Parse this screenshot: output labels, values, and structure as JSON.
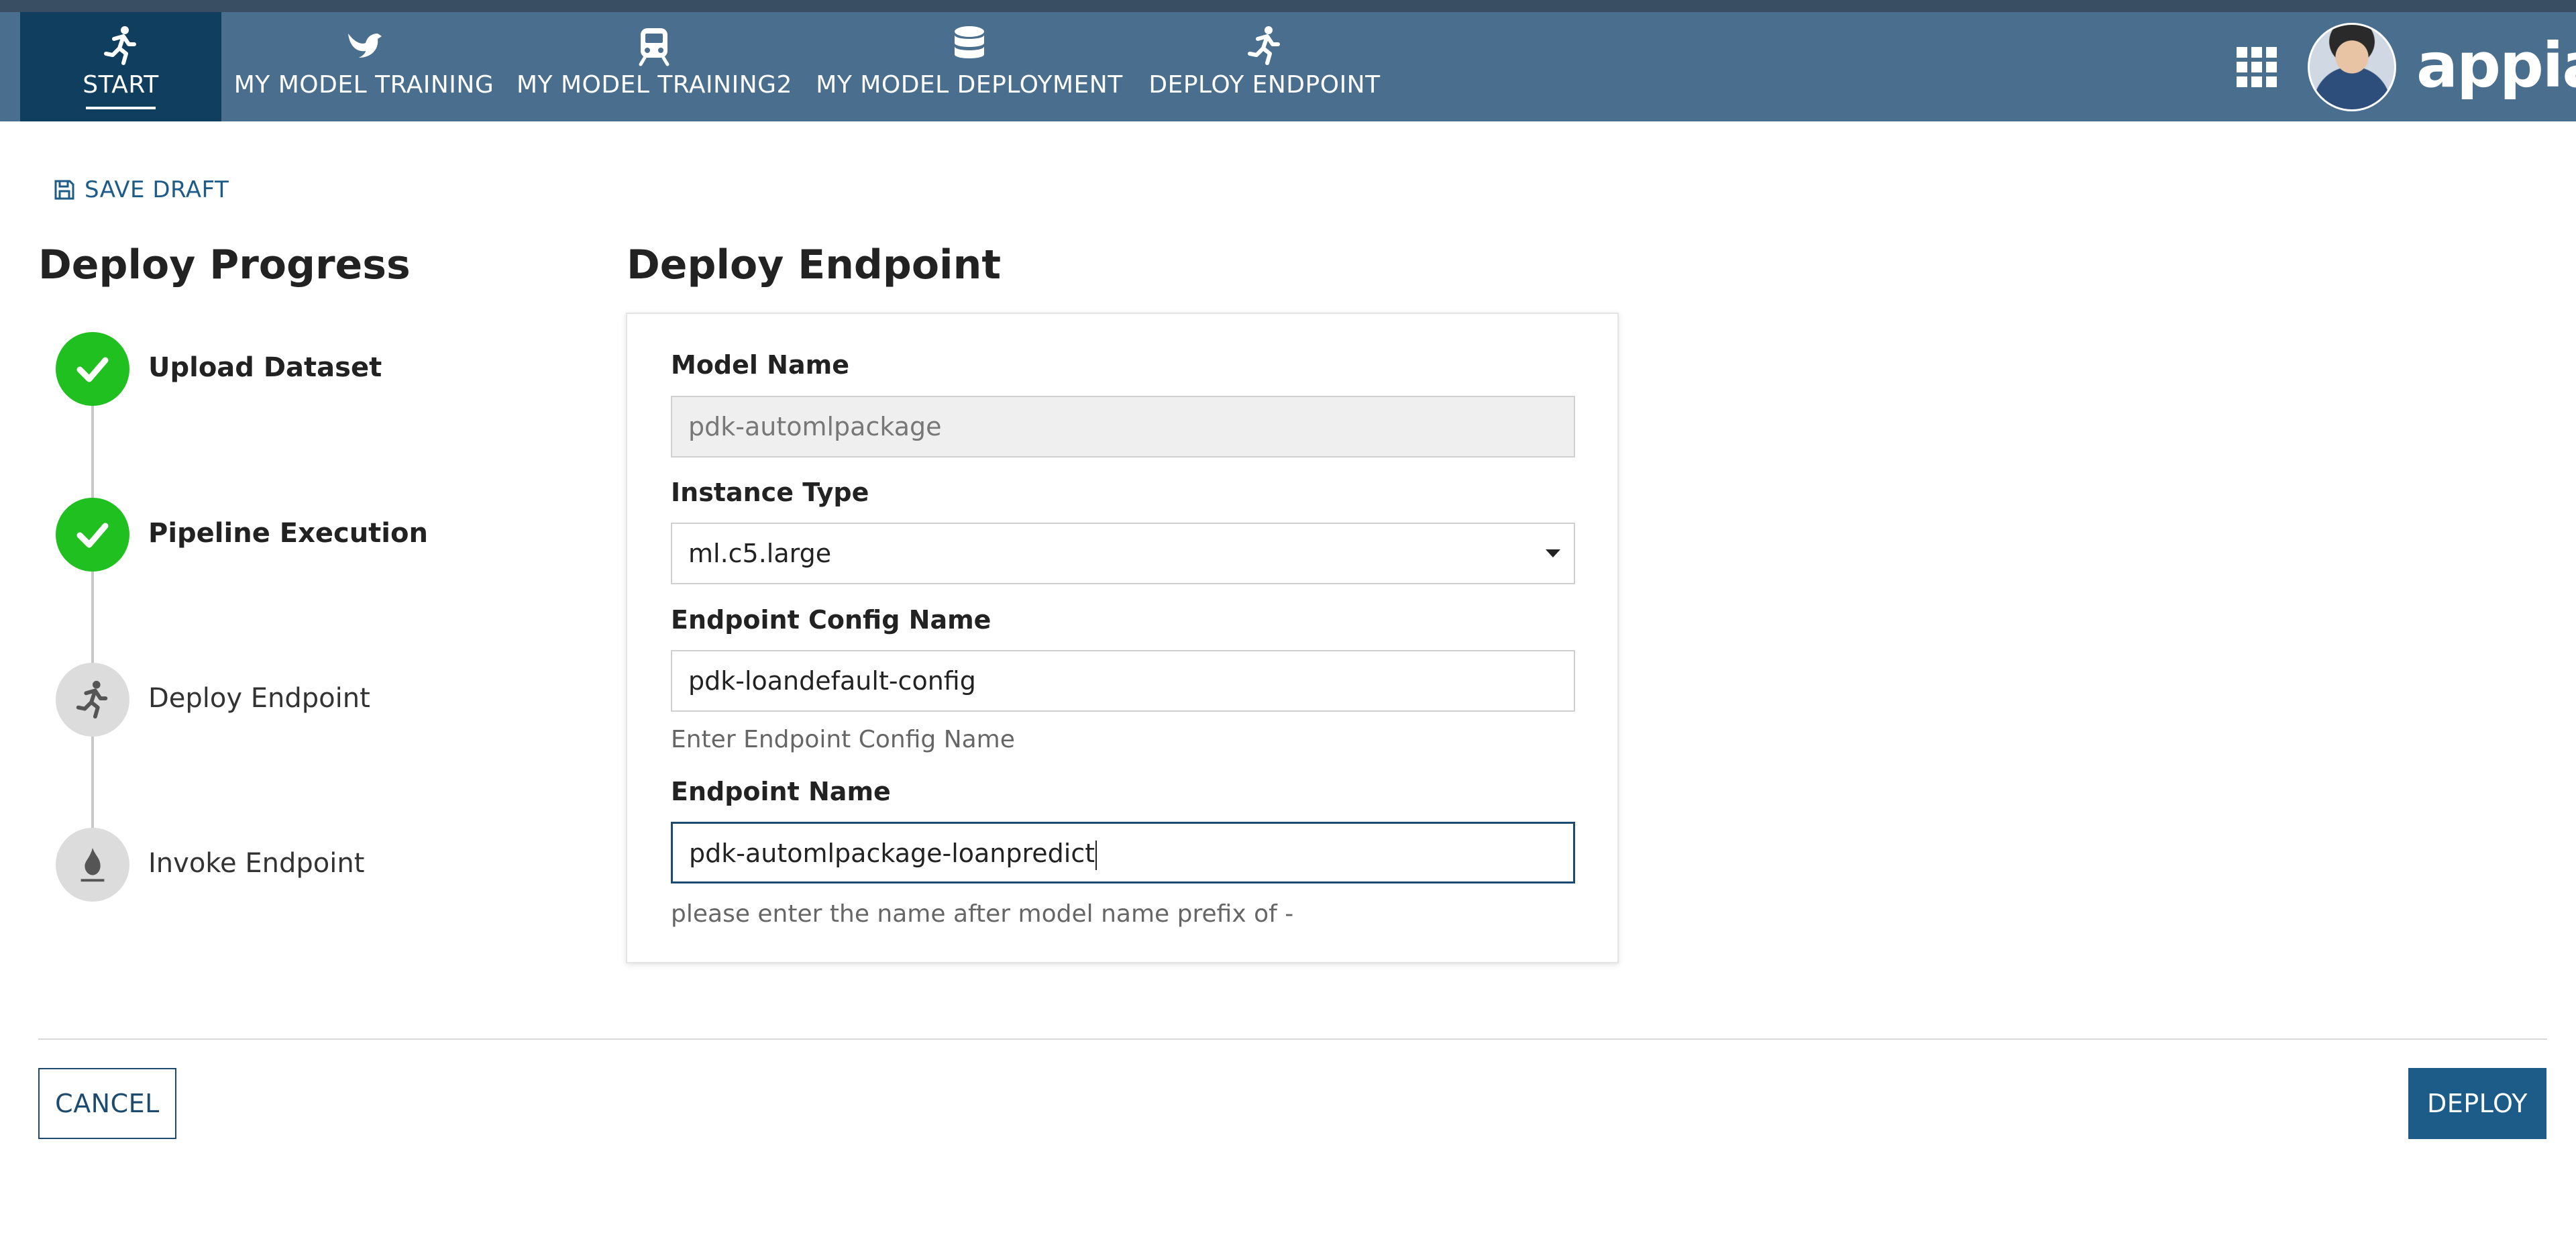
{
  "nav": {
    "items": [
      {
        "label": "START",
        "icon": "runner-icon"
      },
      {
        "label": "MY MODEL TRAINING",
        "icon": "bird-icon"
      },
      {
        "label": "MY MODEL TRAINING2",
        "icon": "train-icon"
      },
      {
        "label": "MY MODEL DEPLOYMENT",
        "icon": "database-icon"
      },
      {
        "label": "DEPLOY ENDPOINT",
        "icon": "runner-icon"
      }
    ],
    "active_index": 0,
    "logo": "appian"
  },
  "toolbar": {
    "save_draft_label": "SAVE DRAFT"
  },
  "progress": {
    "title": "Deploy Progress",
    "steps": [
      {
        "label": "Upload Dataset",
        "status": "done"
      },
      {
        "label": "Pipeline Execution",
        "status": "done"
      },
      {
        "label": "Deploy Endpoint",
        "status": "current"
      },
      {
        "label": "Invoke Endpoint",
        "status": "pending"
      }
    ]
  },
  "form": {
    "title": "Deploy Endpoint",
    "model_name": {
      "label": "Model Name",
      "value": "pdk-automlpackage"
    },
    "instance_type": {
      "label": "Instance Type",
      "value": "ml.c5.large"
    },
    "endpoint_config_name": {
      "label": "Endpoint Config Name",
      "value": "pdk-loandefault-config",
      "helper": "Enter Endpoint Config Name"
    },
    "endpoint_name": {
      "label": "Endpoint Name",
      "value": "pdk-automlpackage-loanpredict",
      "helper": "please enter the name after model name prefix of -"
    }
  },
  "actions": {
    "cancel_label": "CANCEL",
    "deploy_label": "DEPLOY"
  },
  "colors": {
    "navbar": "#4a6f8e",
    "nav_active": "#0f3e5e",
    "step_done": "#20c020",
    "primary": "#1d5b89"
  }
}
